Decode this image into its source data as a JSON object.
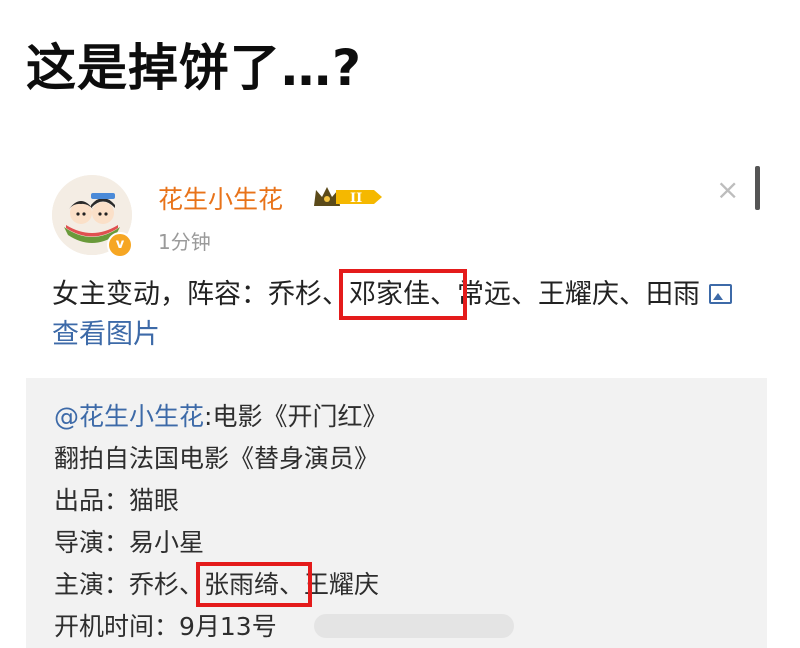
{
  "headline": "这是掉饼了…?",
  "post": {
    "username": "花生小生花",
    "timestamp": "1分钟",
    "close_glyph": "×",
    "verified_badge": "v",
    "vip_badge": "II",
    "text_prefix": "女主变动，阵容：乔杉、",
    "text_highlight": "邓家佳、",
    "text_suffix": "常远、王耀庆、田雨",
    "view_images_label": "查看图片"
  },
  "repost": {
    "mention": "@花生小生花",
    "line1_rest": ":电影《开门红》",
    "line2": "翻拍自法国电影《替身演员》",
    "line3": "出品：猫眼",
    "line4": "导演：易小星",
    "line5_prefix": "主演：乔杉、",
    "line5_highlight": "张雨绮、",
    "line5_suffix": "王耀庆",
    "line6": "开机时间：9月13号"
  },
  "colors": {
    "username": "#e8731a",
    "link": "#3d6aa8",
    "highlight_box": "#e41b1b",
    "repost_bg": "#f2f2f2"
  },
  "icons": [
    "close-icon",
    "image-icon",
    "verified-badge-icon",
    "vip-crown-icon"
  ]
}
